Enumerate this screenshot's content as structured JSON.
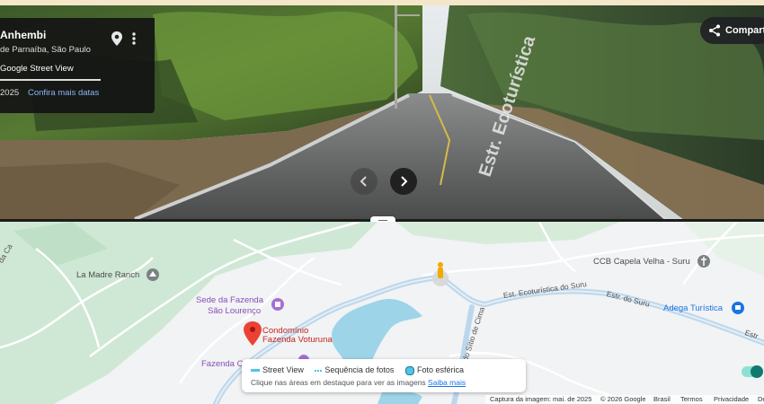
{
  "street_view": {
    "place_title": "Anhembi",
    "place_subtitle": "de Parnaíba, São Paulo",
    "source": "Google Street View",
    "year": "2025",
    "more_dates_link": "Confira mais datas",
    "share_label": "Compart",
    "road_sign_text": "Estr. Ecoturística"
  },
  "map": {
    "labels": {
      "la_madre": "La Madre Ranch",
      "sede_fazenda_1": "Sede da Fazenda",
      "sede_fazenda_2": "São Lourenço",
      "condominio_1": "Condomínio",
      "condominio_2": "Fazenda Voturuna",
      "fazenda": "Fazenda C",
      "ccb": "CCB Capela Velha - Suru",
      "adega": "Adega Turística",
      "estr_ecoturistica": "Est. Ecoturística do Suru",
      "estr_suru": "Estr. do Suru",
      "estr_right": "Estr",
      "do_sitio": "do Sítio de Cima",
      "left_road": "da Ca"
    },
    "legend": {
      "street_view": "Street View",
      "photo_sequence": "Sequência de fotos",
      "spherical_photo": "Foto esférica",
      "hint_text": "Clique nas áreas em destaque para ver as imagens",
      "learn_more": "Saiba mais",
      "toggle_on": true
    },
    "footer": {
      "capture": "Captura da imagem: mai. de 2025",
      "copyright": "© 2026 Google",
      "country": "Brasil",
      "terms": "Termos",
      "privacy": "Privacidade",
      "more": "De"
    }
  },
  "colors": {
    "accent": "#1a73e8",
    "street_view_blue": "#4fc3e8",
    "pin_red": "#ea4335",
    "pegman": "#f2a900"
  }
}
